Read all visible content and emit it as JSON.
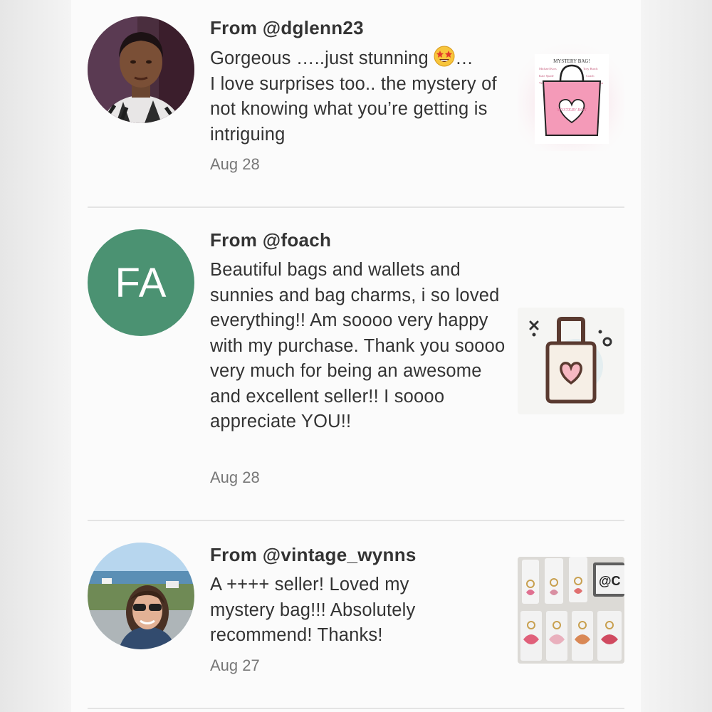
{
  "reviews": [
    {
      "from": "From @dglenn23",
      "text": "Gorgeous …..just stunning",
      "text_suffix": "…",
      "text_rest": "I love surprises too.. the mystery of not knowing what you’re getting is intriguing",
      "date": "Aug 28",
      "emoji": "star-struck-emoji",
      "thumb": {
        "title": "MYSTERY BAG!",
        "brands_left": [
          "Michael Kors",
          "Kate Spade",
          "Vera Bradley"
        ],
        "brands_right": [
          "Tory Burch",
          "Coach",
          "Betsey Johnson"
        ],
        "bag_label": "MYSTERY BOX"
      }
    },
    {
      "from": "From @foach",
      "initials": "FA",
      "avatar_color": "#4b9272",
      "text": "Beautiful bags and wallets and sunnies and bag charms, i so loved everything!! Am soooo very happy with my purchase. Thank you soooo very much for being an awesome and excellent seller!! I soooo appreciate YOU!!",
      "date": "Aug 28",
      "thumb_icon": "tote-bag-heart-icon"
    },
    {
      "from": "From @vintage_wynns",
      "text": "A ++++ seller! Loved my mystery bag!!! Absolutely recommend! Thanks!",
      "date": "Aug 27",
      "thumb": {
        "sign_text": "@C"
      }
    }
  ],
  "colors": {
    "text": "#333333",
    "date": "#777777",
    "divider": "#e4e4e4",
    "pink": "#f49ab8"
  }
}
